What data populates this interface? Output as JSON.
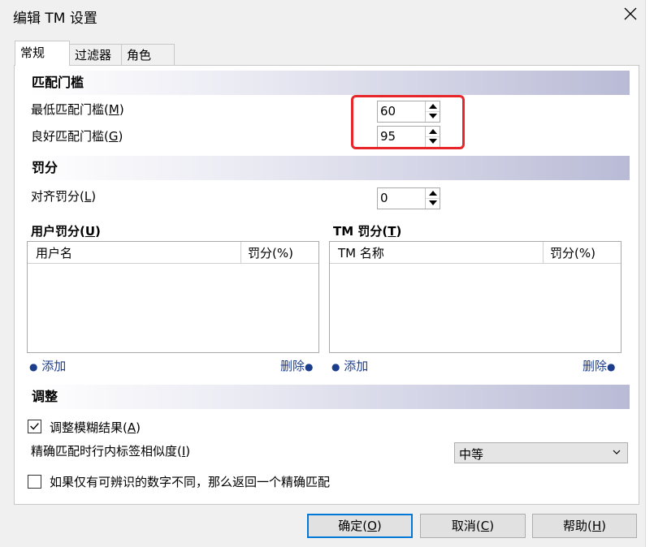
{
  "window": {
    "title": "编辑 TM 设置"
  },
  "tabs": [
    {
      "label": "常规"
    },
    {
      "label": "过滤器"
    },
    {
      "label": "角色"
    }
  ],
  "match_threshold": {
    "heading": "匹配门槛",
    "min_label": "最低匹配门槛(",
    "min_key": "M",
    "min_value": "60",
    "good_label": "良好匹配门槛(",
    "good_key": "G",
    "good_value": "95"
  },
  "penalty": {
    "heading": "罚分",
    "align_label": "对齐罚分(",
    "align_key": "L",
    "align_value": "0"
  },
  "user_penalty": {
    "title_pre": "用户罚分(",
    "title_key": "U",
    "col_name": "用户名",
    "col_penalty": "罚分(%)",
    "add": "添加",
    "delete": "删除"
  },
  "tm_penalty": {
    "title_pre": "TM 罚分(",
    "title_key": "T",
    "col_name": "TM 名称",
    "col_penalty": "罚分(%)",
    "add": "添加",
    "delete": "删除"
  },
  "adjust": {
    "heading": "调整",
    "fuzzy_label": "调整模糊结果(",
    "fuzzy_key": "A",
    "fuzzy_checked": true,
    "inline_label": "精确匹配时行内标签相似度(",
    "inline_key": "I",
    "inline_select": "中等",
    "digits_label": "如果仅有可辨识的数字不同，那么返回一个精确匹配",
    "digits_checked": false
  },
  "buttons": {
    "ok_label": "确定(",
    "ok_key": "O",
    "cancel_label": "取消(",
    "cancel_key": "C",
    "help_label": "帮助(",
    "help_key": "H",
    "close_paren": ")"
  }
}
